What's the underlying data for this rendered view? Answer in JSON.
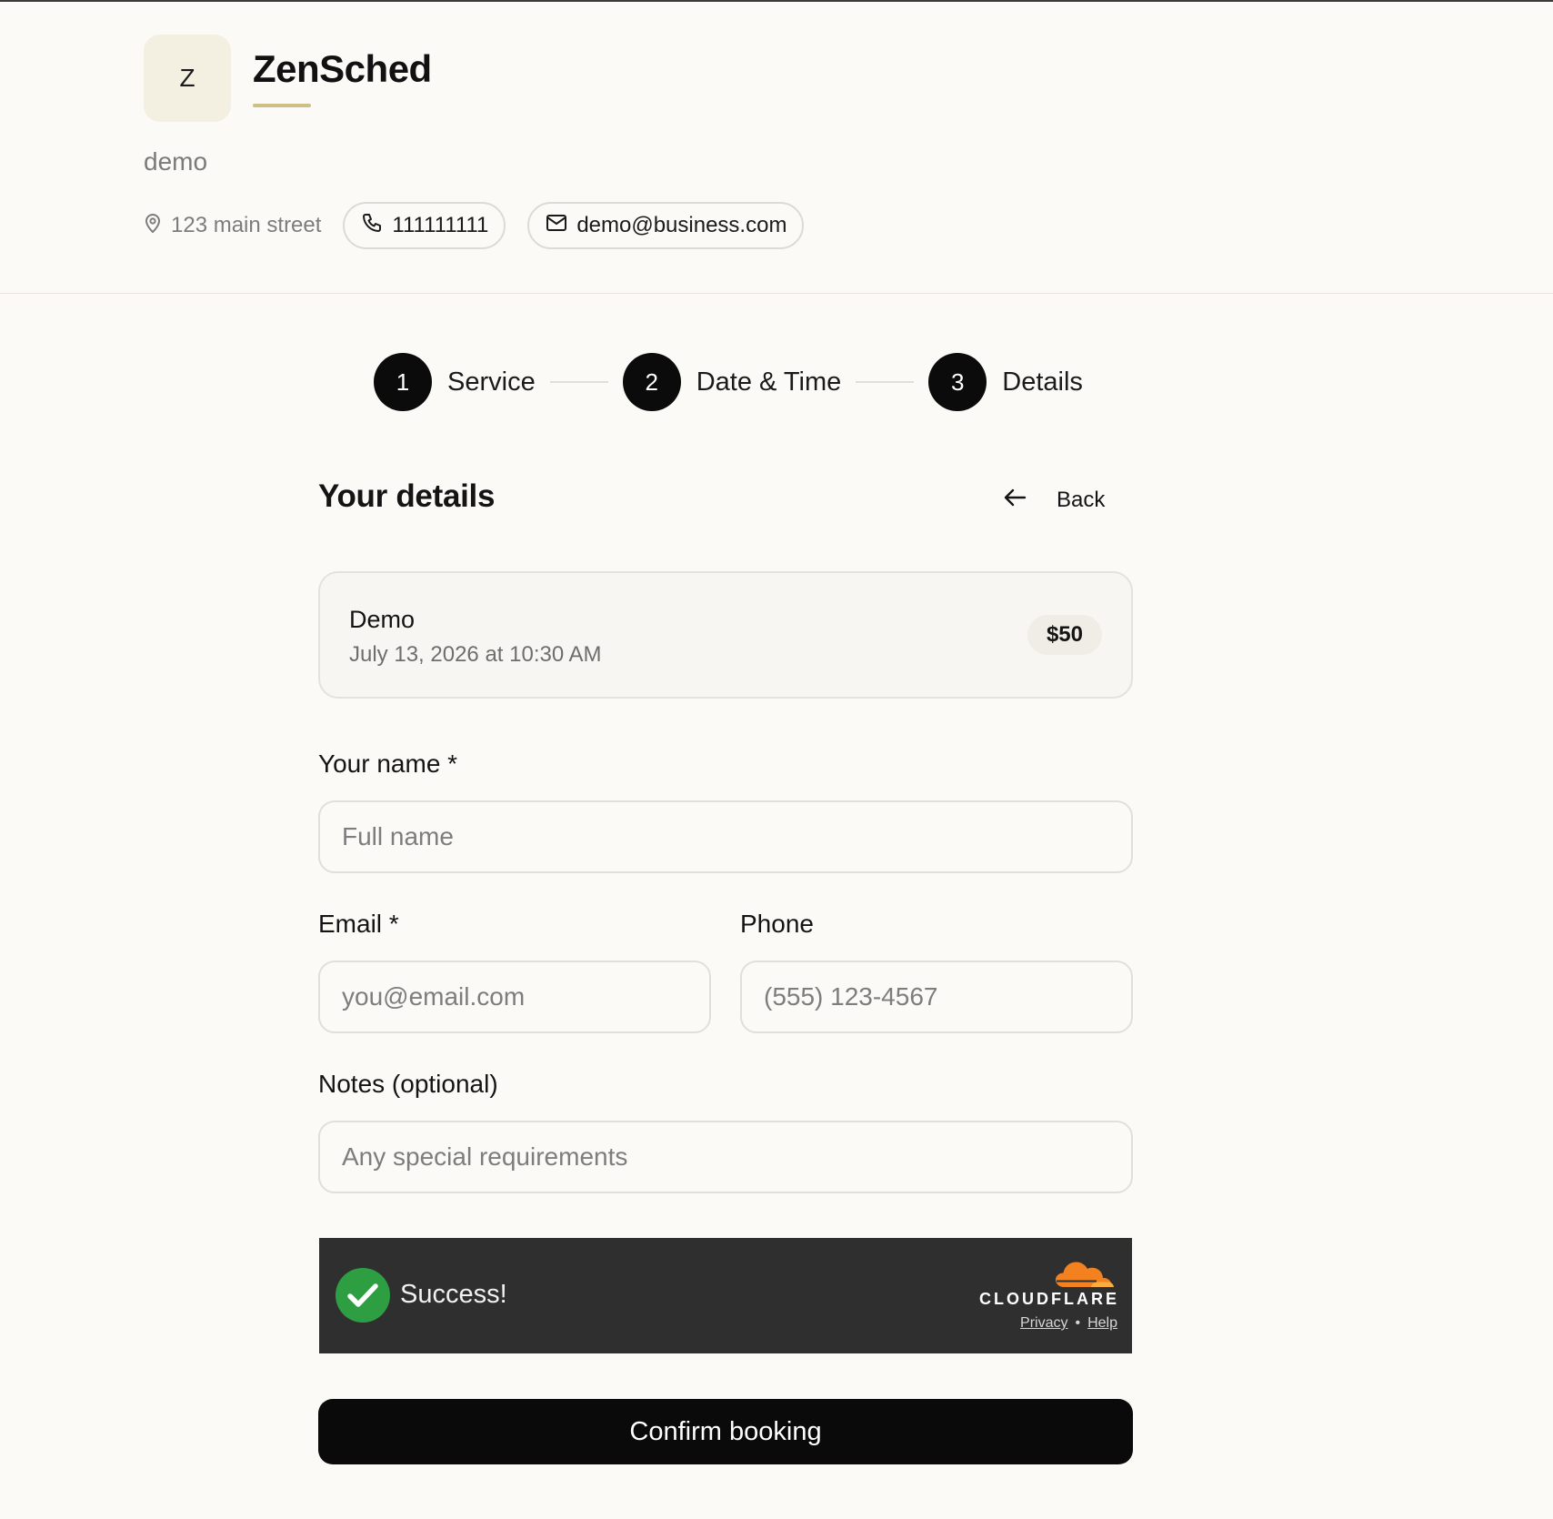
{
  "business": {
    "logo_initial": "Z",
    "name": "ZenSched",
    "tagline": "demo",
    "address": "123 main street",
    "phone": "111111111",
    "email": "demo@business.com"
  },
  "steps": [
    {
      "number": "1",
      "label": "Service"
    },
    {
      "number": "2",
      "label": "Date & Time"
    },
    {
      "number": "3",
      "label": "Details"
    }
  ],
  "page": {
    "title": "Your details",
    "back_label": "Back"
  },
  "summary": {
    "service": "Demo",
    "datetime": "July 13, 2026 at 10:30 AM",
    "price": "$50"
  },
  "form": {
    "name_label": "Your name *",
    "name_placeholder": "Full name",
    "email_label": "Email *",
    "email_placeholder": "you@email.com",
    "phone_label": "Phone",
    "phone_placeholder": "(555) 123-4567",
    "notes_label": "Notes (optional)",
    "notes_placeholder": "Any special requirements"
  },
  "captcha": {
    "status": "Success!",
    "provider": "CLOUDFLARE",
    "privacy_link": "Privacy",
    "separator": "•",
    "help_link": "Help"
  },
  "confirm_label": "Confirm booking",
  "colors": {
    "background": "#fbfaf7",
    "accent": "#cdbf86",
    "primary": "#0a0a0a",
    "success": "#2e9e42",
    "cloudflare_orange": "#f48120"
  }
}
